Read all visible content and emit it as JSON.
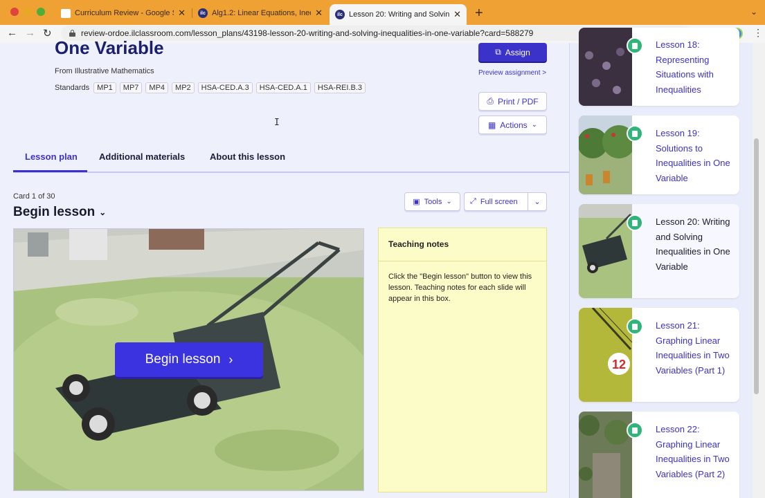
{
  "browser": {
    "tabs": [
      {
        "title": "Curriculum Review - Google Sl",
        "favicon": "google-slides-icon"
      },
      {
        "title": "Alg1.2: Linear Equations, Inequ",
        "favicon": "ilc-icon"
      },
      {
        "title": "Lesson 20: Writing and Solving",
        "favicon": "ilc-icon",
        "active": true
      }
    ],
    "url": "review-ordoe.ilclassroom.com/lesson_plans/43198-lesson-20-writing-and-solving-inequalities-in-one-variable?card=588279"
  },
  "lesson": {
    "title": "One Variable",
    "from_label": "From",
    "from_source": "Illustrative Mathematics",
    "standards_label": "Standards",
    "standards": [
      "MP1",
      "MP7",
      "MP4",
      "MP2",
      "HSA-CED.A.3",
      "HSA-CED.A.1",
      "HSA-REI.B.3"
    ]
  },
  "actions": {
    "assign": "Assign",
    "preview": "Preview assignment >",
    "print": "Print / PDF",
    "actions": "Actions"
  },
  "lesson_tabs": [
    "Lesson plan",
    "Additional materials",
    "About this lesson"
  ],
  "card": {
    "counter": "Card 1 of 30",
    "heading": "Begin lesson",
    "tools": "Tools",
    "full_screen": "Full screen",
    "begin_button": "Begin lesson"
  },
  "notes": {
    "title": "Teaching notes",
    "body": "Click the \"Begin lesson\" button to view this lesson. Teaching notes for each slide will appear in this box."
  },
  "sidebar": {
    "lessons": [
      {
        "title": "Lesson 18: Representing Situations with Inequalities"
      },
      {
        "title": "Lesson 19: Solutions to Inequalities in One Variable"
      },
      {
        "title": "Lesson 20: Writing and Solving Inequalities in One Variable",
        "current": true
      },
      {
        "title": "Lesson 21: Graphing Linear Inequalities in Two Variables (Part 1)",
        "thumb_text": "12"
      },
      {
        "title": "Lesson 22: Graphing Linear Inequalities in Two Variables (Part 2)"
      }
    ]
  },
  "colors": {
    "accent": "#3b32c9",
    "tabbar": "#f0a133",
    "notes_bg": "#fcfcc8",
    "badge": "#2fb57a"
  }
}
